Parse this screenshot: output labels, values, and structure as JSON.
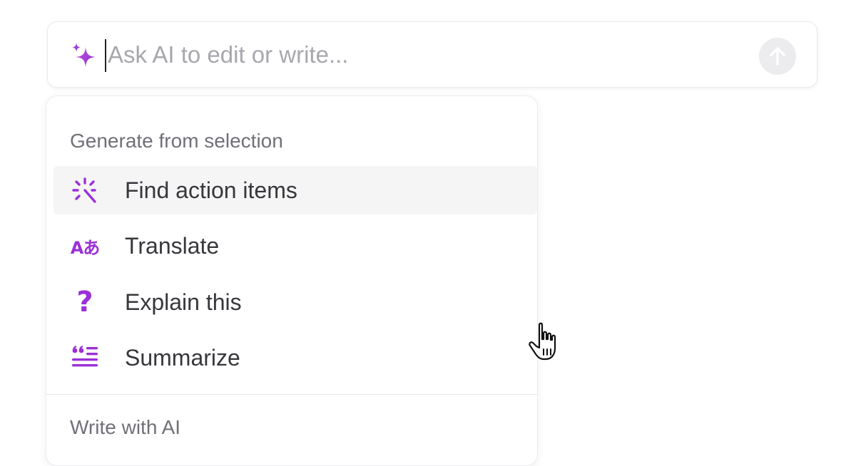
{
  "prompt": {
    "placeholder": "Ask AI to edit or write...",
    "value": "",
    "leading_icon": "sparkle-icon",
    "send_icon": "arrow-up-icon"
  },
  "menu": {
    "sections": [
      {
        "header": "Generate from selection",
        "items": [
          {
            "label": "Find action items",
            "icon": "magic-wand-icon",
            "highlighted": true
          },
          {
            "label": "Translate",
            "icon": "translate-icon",
            "glyph": "Aあ"
          },
          {
            "label": "Explain this",
            "icon": "question-icon",
            "glyph": "?"
          },
          {
            "label": "Summarize",
            "icon": "summarize-quote-icon"
          }
        ]
      },
      {
        "header": "Write with AI",
        "items": []
      }
    ]
  },
  "colors": {
    "accent": "#9b30d6",
    "text": "#37373c",
    "muted": "#707078",
    "placeholder": "#a7a7ad",
    "highlight_bg": "#f5f5f6"
  }
}
